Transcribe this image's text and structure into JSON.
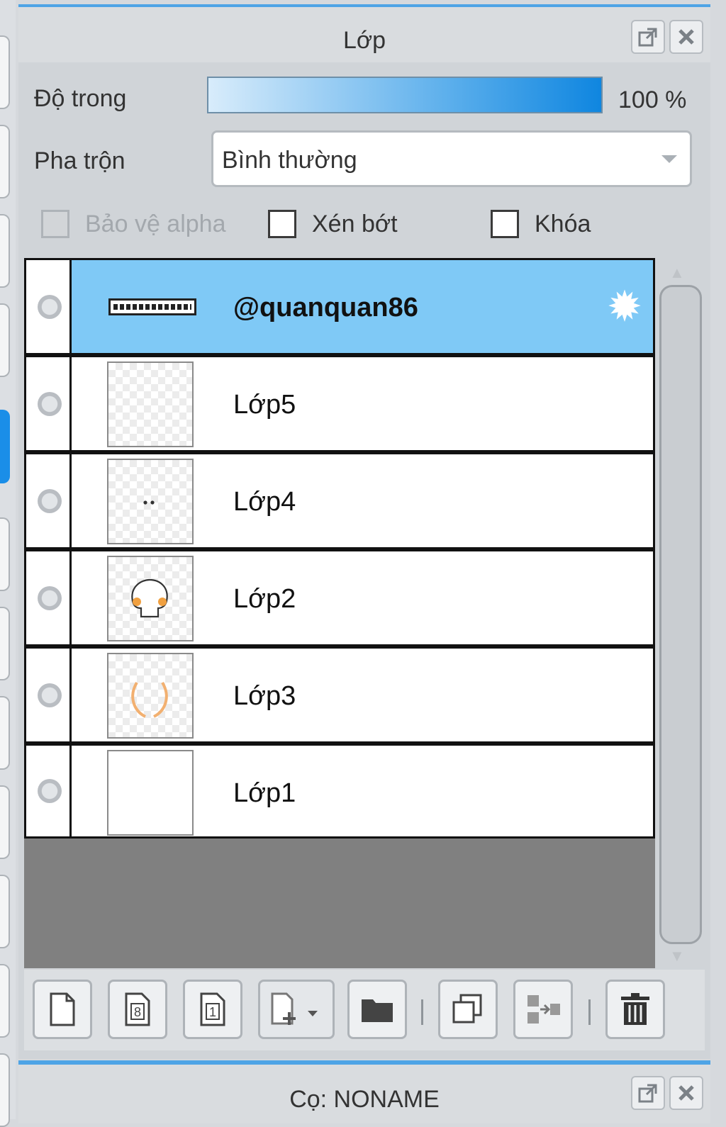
{
  "panel": {
    "title": "Lớp",
    "opacity": {
      "label": "Độ trong",
      "value_text": "100 %",
      "value": 1.0
    },
    "blend": {
      "label": "Pha trộn",
      "selected": "Bình thường"
    },
    "checkboxes": [
      {
        "label": "Bảo vệ alpha",
        "checked": false,
        "enabled": false
      },
      {
        "label": "Xén bớt",
        "checked": false,
        "enabled": true
      },
      {
        "label": "Khóa",
        "checked": false,
        "enabled": true
      }
    ],
    "layers": [
      {
        "name": "@quanquan86",
        "selected": true,
        "thumb": "text",
        "has_gear": true
      },
      {
        "name": "Lớp5",
        "selected": false,
        "thumb": "transparent"
      },
      {
        "name": "Lớp4",
        "selected": false,
        "thumb": "dots"
      },
      {
        "name": "Lớp2",
        "selected": false,
        "thumb": "skull"
      },
      {
        "name": "Lớp3",
        "selected": false,
        "thumb": "arcs"
      },
      {
        "name": "Lớp1",
        "selected": false,
        "thumb": "white"
      }
    ],
    "toolbar_icons": [
      "new-layer-icon",
      "new-8bit-layer-icon",
      "new-1bit-layer-icon",
      "add-layer-dropdown-icon",
      "folder-icon",
      "duplicate-layer-icon",
      "merge-down-icon",
      "trash-icon"
    ]
  },
  "brush_panel": {
    "title": "Cọ: NONAME"
  },
  "colors": {
    "accent": "#4ea4e6",
    "selected_row": "#7fc9f6",
    "opacity_fill": "#0f86e0"
  }
}
